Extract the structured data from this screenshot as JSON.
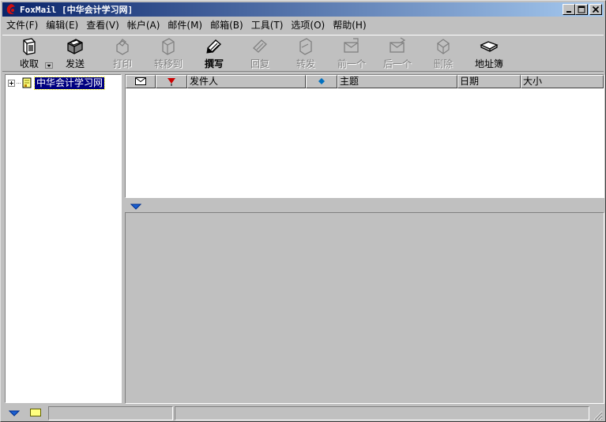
{
  "window": {
    "title": "FoxMail [中华会计学习网]"
  },
  "menu": {
    "items": [
      {
        "label": "文件(F)",
        "name": "menu-file"
      },
      {
        "label": "编辑(E)",
        "name": "menu-edit"
      },
      {
        "label": "查看(V)",
        "name": "menu-view"
      },
      {
        "label": "帐户(A)",
        "name": "menu-account"
      },
      {
        "label": "邮件(M)",
        "name": "menu-mail"
      },
      {
        "label": "邮箱(B)",
        "name": "menu-mailbox"
      },
      {
        "label": "工具(T)",
        "name": "menu-tools"
      },
      {
        "label": "选项(O)",
        "name": "menu-options"
      },
      {
        "label": "帮助(H)",
        "name": "menu-help"
      }
    ]
  },
  "toolbar": {
    "receive": "收取",
    "send": "发送",
    "print": "打印",
    "move": "转移到",
    "compose": "撰写",
    "reply": "回复",
    "forward": "转发",
    "previous": "前一个",
    "next": "后一个",
    "delete": "删除",
    "addressbook": "地址簿"
  },
  "tree": {
    "root_label": "中华会计学习网"
  },
  "message_list": {
    "columns": {
      "from": "发件人",
      "subject": "主题",
      "date": "日期",
      "size": "大小"
    }
  },
  "colors": {
    "title_gradient_start": "#0a246a",
    "title_gradient_end": "#a6caf0",
    "selection": "#000080",
    "flag": "#cc0000",
    "priority": "#0070c0",
    "arrow_blue": "#1a5fd0"
  }
}
